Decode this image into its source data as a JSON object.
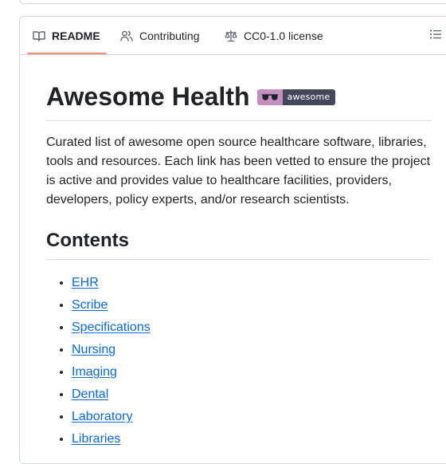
{
  "tabs": [
    {
      "label": "README",
      "icon": "book-icon",
      "active": true
    },
    {
      "label": "Contributing",
      "icon": "people-icon",
      "active": false
    },
    {
      "label": "CC0-1.0 license",
      "icon": "law-icon",
      "active": false
    }
  ],
  "outline_icon": "list-unordered-icon",
  "readme": {
    "title": "Awesome Health",
    "badge": {
      "icon": "sunglasses-icon",
      "text": "awesome",
      "left_color": "#c28fbe",
      "right_color": "#44475a"
    },
    "description": "Curated list of awesome open source healthcare software, libraries, tools and resources. Each link has been vetted to ensure the project is active and provides value to healthcare facilities, providers, developers, policy experts, and/or research scientists.",
    "contents_heading": "Contents",
    "contents": [
      "EHR",
      "Scribe",
      "Specifications",
      "Nursing",
      "Imaging",
      "Dental",
      "Laboratory",
      "Libraries"
    ]
  },
  "colors": {
    "link": "#0969da",
    "active_tab_underline": "#fd8c73",
    "border": "#d0d7de"
  }
}
